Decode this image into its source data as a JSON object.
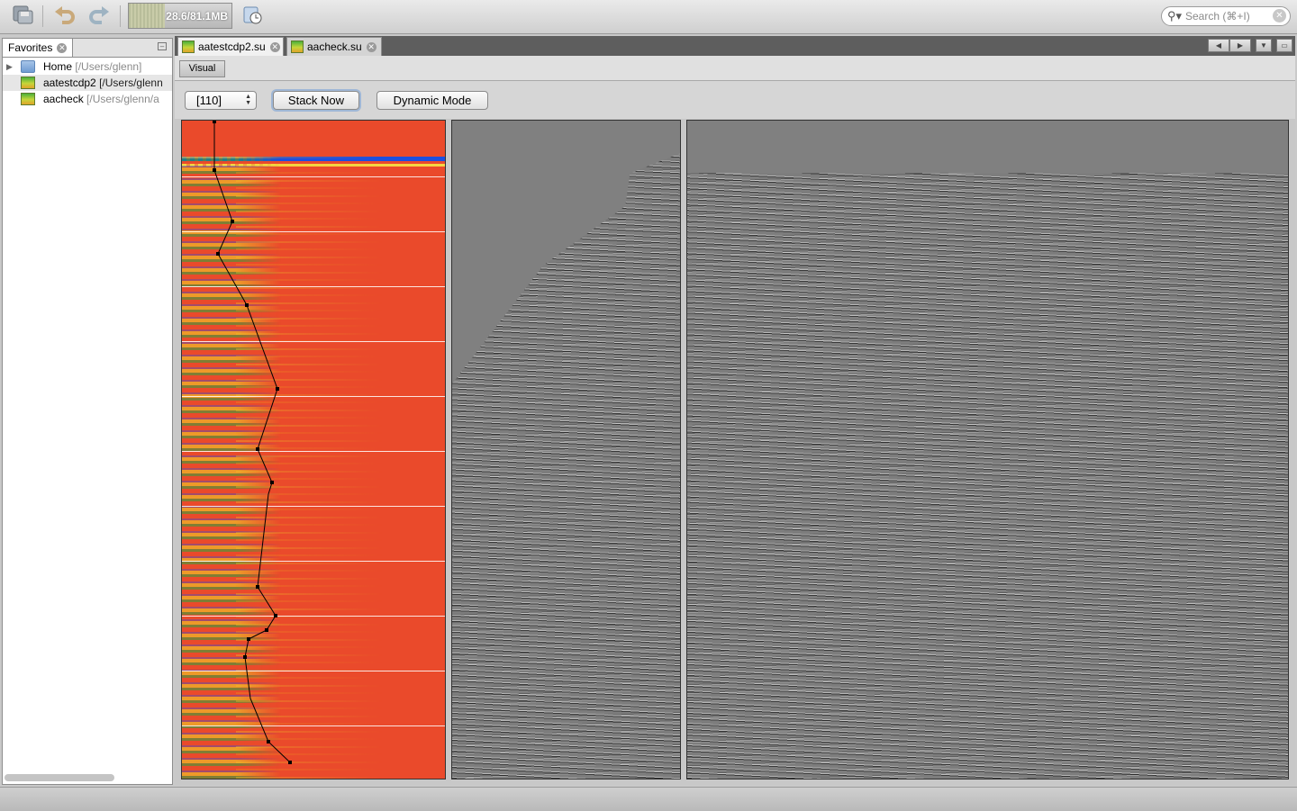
{
  "toolbar": {
    "icons": [
      "save-icon",
      "undo-icon",
      "redo-icon",
      "gc-icon"
    ],
    "memory_label": "28.6/81.1MB",
    "memory_fraction": 0.353,
    "search_placeholder": "Search (⌘+I)"
  },
  "sidebar": {
    "tab_label": "Favorites",
    "items": [
      {
        "name": "Home",
        "path": "[/Users/glenn]",
        "icon": "folder-icon"
      },
      {
        "name": "aatestcdp2",
        "path": "[/Users/glenn",
        "icon": "seismic-file-icon"
      },
      {
        "name": "aacheck",
        "path": "[/Users/glenn/a",
        "icon": "seismic-file-icon"
      }
    ]
  },
  "editor": {
    "tabs": [
      {
        "label": "aatestcdp2.su",
        "active": true
      },
      {
        "label": "aacheck.su",
        "active": false
      }
    ],
    "view_tab": "Visual",
    "controls": {
      "cdp_select": "[110]",
      "stack_now": "Stack Now",
      "dynamic_mode": "Dynamic Mode"
    }
  },
  "colors": {
    "semblance_bg": "#ea4a2b",
    "semblance_low": "#1b4fe0",
    "panel_gray": "#808080"
  }
}
